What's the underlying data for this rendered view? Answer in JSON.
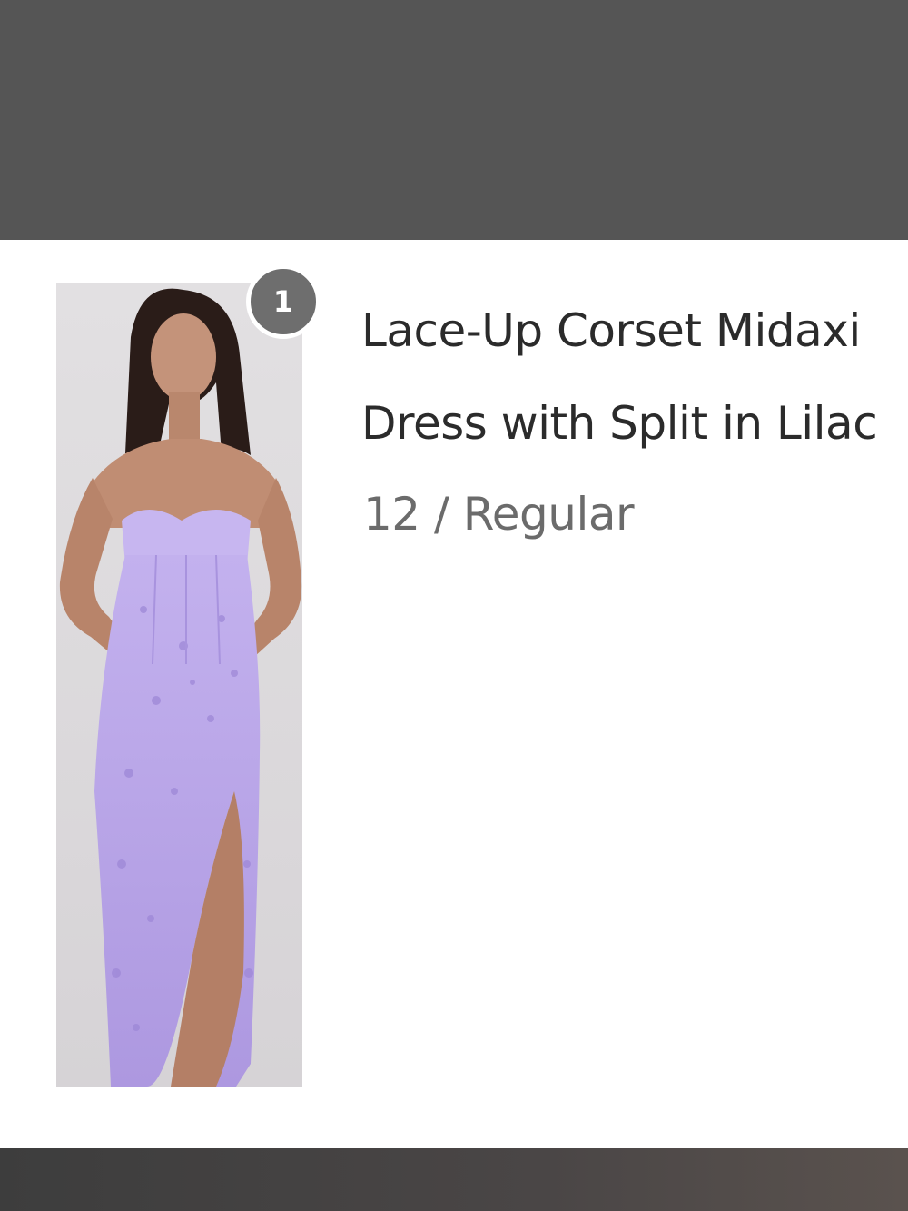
{
  "order_item": {
    "quantity_badge": "1",
    "title_line_1": "Lace-Up Corset Midaxi",
    "title_line_2": "Dress with Split in Lilac",
    "variant": "12 / Regular"
  },
  "colors": {
    "top_bar": "#555555",
    "badge": "#6e6e6e",
    "title_text": "#2b2b2b",
    "variant_text": "#6b6b6b",
    "dress": "#b8a4e6"
  },
  "icons": {
    "product_image": "lilac-strapless-corset-dress-photo"
  }
}
